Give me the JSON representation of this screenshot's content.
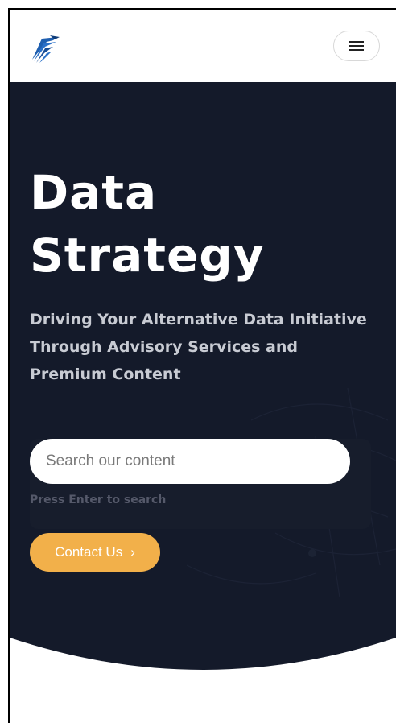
{
  "header": {
    "logo_icon": "eagle-logo-icon",
    "menu_icon": "hamburger-menu-icon"
  },
  "hero": {
    "title_line1": "Data",
    "title_line2": "Strategy",
    "subtitle_line1": "Driving Your Alternative Data Initiative",
    "subtitle_line2": "Through Advisory Services and",
    "subtitle_line3": "Premium Content"
  },
  "search": {
    "placeholder": "Search our content",
    "value": "",
    "hint": "Press Enter to search"
  },
  "contact": {
    "label": "Contact Us",
    "arrow": "›"
  },
  "colors": {
    "hero_bg": "#141a2a",
    "accent": "#f2b04a",
    "logo_blue": "#1f5fb0"
  }
}
